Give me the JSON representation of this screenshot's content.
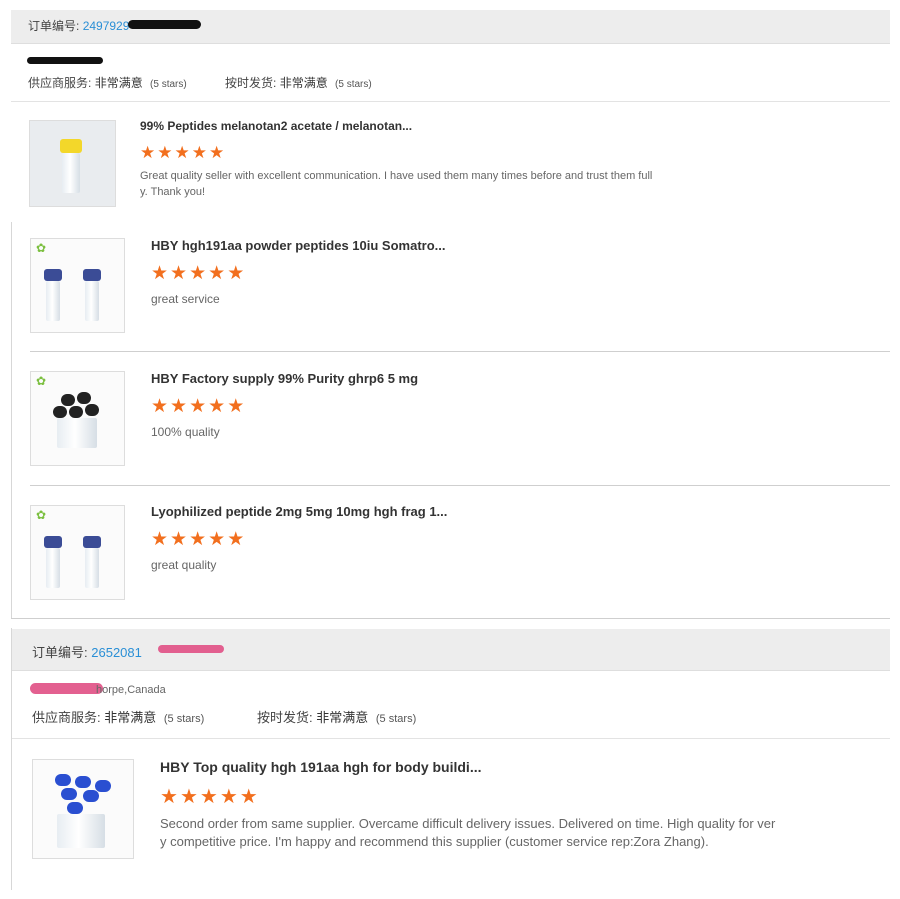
{
  "order1": {
    "label": "订单编号:",
    "number": "2497929",
    "location": "",
    "supplier_service_label": "供应商服务:",
    "supplier_service_value": "非常满意",
    "supplier_service_stars": "(5 stars)",
    "shipping_label": "按时发货:",
    "shipping_value": "非常满意",
    "shipping_stars": "(5 stars)",
    "items": [
      {
        "title": "99% Peptides melanotan2 acetate / melanotan...",
        "rating": 5,
        "review": "Great quality seller with excellent communication. I have used them many times before and trust them full y. Thank you!",
        "review_l1": "Great quality seller with excellent communication. I have used them many times before and trust them full",
        "review_l2": "y. Thank you!",
        "image": "yellow-cap-vial"
      },
      {
        "title": "HBY hgh191aa powder peptides 10iu Somatro...",
        "rating": 5,
        "review": "great service",
        "image": "two-blue-cap-vials"
      },
      {
        "title": "HBY Factory supply 99% Purity ghrp6 5 mg",
        "rating": 5,
        "review": "100% quality",
        "image": "black-cap-vials-cluster"
      },
      {
        "title": "Lyophilized peptide 2mg 5mg 10mg hgh frag 1...",
        "rating": 5,
        "review": "great quality",
        "image": "two-blue-cap-vials"
      }
    ]
  },
  "order2": {
    "label": "订单编号:",
    "number": "2652081",
    "location": "horpe,Canada",
    "supplier_service_label": "供应商服务:",
    "supplier_service_value": "非常满意",
    "supplier_service_stars": "(5 stars)",
    "shipping_label": "按时发货:",
    "shipping_value": "非常满意",
    "shipping_stars": "(5 stars)",
    "items": [
      {
        "title": "HBY Top quality hgh 191aa hgh for body buildi...",
        "rating": 5,
        "review": "Second order from same supplier. Overcame difficult delivery issues. Delivered on time. High quality for very competitive price. I'm happy and recommend this supplier (customer service rep:Zora Zhang).",
        "review_l1": "Second order from same supplier. Overcame difficult delivery issues. Delivered on time. High quality for ver",
        "review_l2": "y competitive price. I'm happy and recommend this supplier (customer service rep:Zora Zhang).",
        "image": "blue-cap-vials-cluster"
      }
    ]
  },
  "colors": {
    "star": "#f26f1e",
    "order_number": "#2a8fd6",
    "header_bar": "#ededed",
    "redaction_black": "#111111",
    "redaction_pink": "#e2578a"
  },
  "star_glyph": "★"
}
